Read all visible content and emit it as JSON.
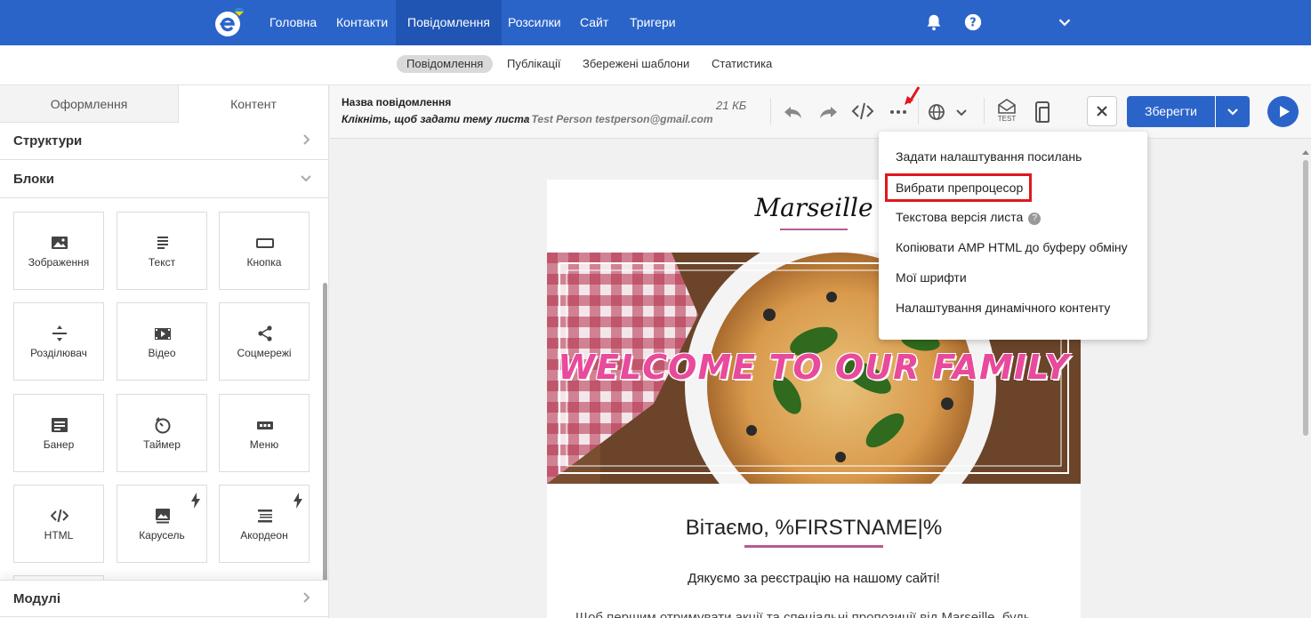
{
  "topnav": {
    "items": [
      {
        "label": "Головна",
        "active": false
      },
      {
        "label": "Контакти",
        "active": false
      },
      {
        "label": "Повідомлення",
        "active": true
      },
      {
        "label": "Розсилки",
        "active": false
      },
      {
        "label": "Сайт",
        "active": false
      },
      {
        "label": "Тригери",
        "active": false
      }
    ],
    "icons": [
      "bell-icon",
      "help-icon",
      "chevron-down-icon"
    ],
    "bg_color": "#2b64c9"
  },
  "subnav": {
    "items": [
      {
        "label": "Повідомлення",
        "active": true
      },
      {
        "label": "Публікації",
        "active": false
      },
      {
        "label": "Збережені шаблони",
        "active": false
      },
      {
        "label": "Статистика",
        "active": false
      }
    ]
  },
  "left_panel": {
    "tabs": [
      {
        "label": "Оформлення",
        "active": false
      },
      {
        "label": "Контент",
        "active": true
      }
    ],
    "sections": {
      "structures": "Структури",
      "blocks": "Блоки",
      "modules": "Модулі"
    },
    "blocks": [
      {
        "label": "Зображення",
        "icon": "image-icon",
        "premium": false
      },
      {
        "label": "Текст",
        "icon": "text-icon",
        "premium": false
      },
      {
        "label": "Кнопка",
        "icon": "button-icon",
        "premium": false
      },
      {
        "label": "Розділювач",
        "icon": "divider-icon",
        "premium": false
      },
      {
        "label": "Відео",
        "icon": "video-icon",
        "premium": false
      },
      {
        "label": "Соцмережі",
        "icon": "share-icon",
        "premium": false
      },
      {
        "label": "Банер",
        "icon": "banner-icon",
        "premium": false
      },
      {
        "label": "Таймер",
        "icon": "timer-icon",
        "premium": false
      },
      {
        "label": "Меню",
        "icon": "menu-icon",
        "premium": false
      },
      {
        "label": "HTML",
        "icon": "code-icon",
        "premium": false
      },
      {
        "label": "Карусель",
        "icon": "carousel-icon",
        "premium": true
      },
      {
        "label": "Акордеон",
        "icon": "accordion-icon",
        "premium": true
      }
    ]
  },
  "toolbar": {
    "message_name": "Назва повідомлення",
    "subject_placeholder": "Клікніть, щоб задати тему листа",
    "sender": "• Test Person testperson@gmail.com",
    "size": "21 КБ",
    "test_label": "TEST",
    "save_label": "Зберегти"
  },
  "dropdown": {
    "items": [
      {
        "label": "Задати налаштування посилань",
        "highlighted": false,
        "help": false
      },
      {
        "label": "Вибрати препроцесор",
        "highlighted": true,
        "help": false
      },
      {
        "label": "Текстова версія листа",
        "highlighted": false,
        "help": true
      },
      {
        "label": "Копіювати AMP HTML до буферу обміну",
        "highlighted": false,
        "help": false
      },
      {
        "label": "Мої шрифти",
        "highlighted": false,
        "help": false
      },
      {
        "label": "Налаштування динамічного контенту",
        "highlighted": false,
        "help": false
      }
    ],
    "help_glyph": "?"
  },
  "email": {
    "brand": "Marseille",
    "hero_text": "WELCOME TO OUR FAMILY",
    "greeting": "Вітаємо, %FIRSTNAME|%",
    "thanks": "Дякуємо за реєстрацію на нашому сайті!",
    "body_cut": "Щоб першим отримувати акції та спеціальні пропозиції від Marseille, будь"
  },
  "colors": {
    "accent": "#2b64c9",
    "highlight": "#e0171e",
    "brand_pink": "#e84a9c",
    "divider": "#b65c8f"
  }
}
